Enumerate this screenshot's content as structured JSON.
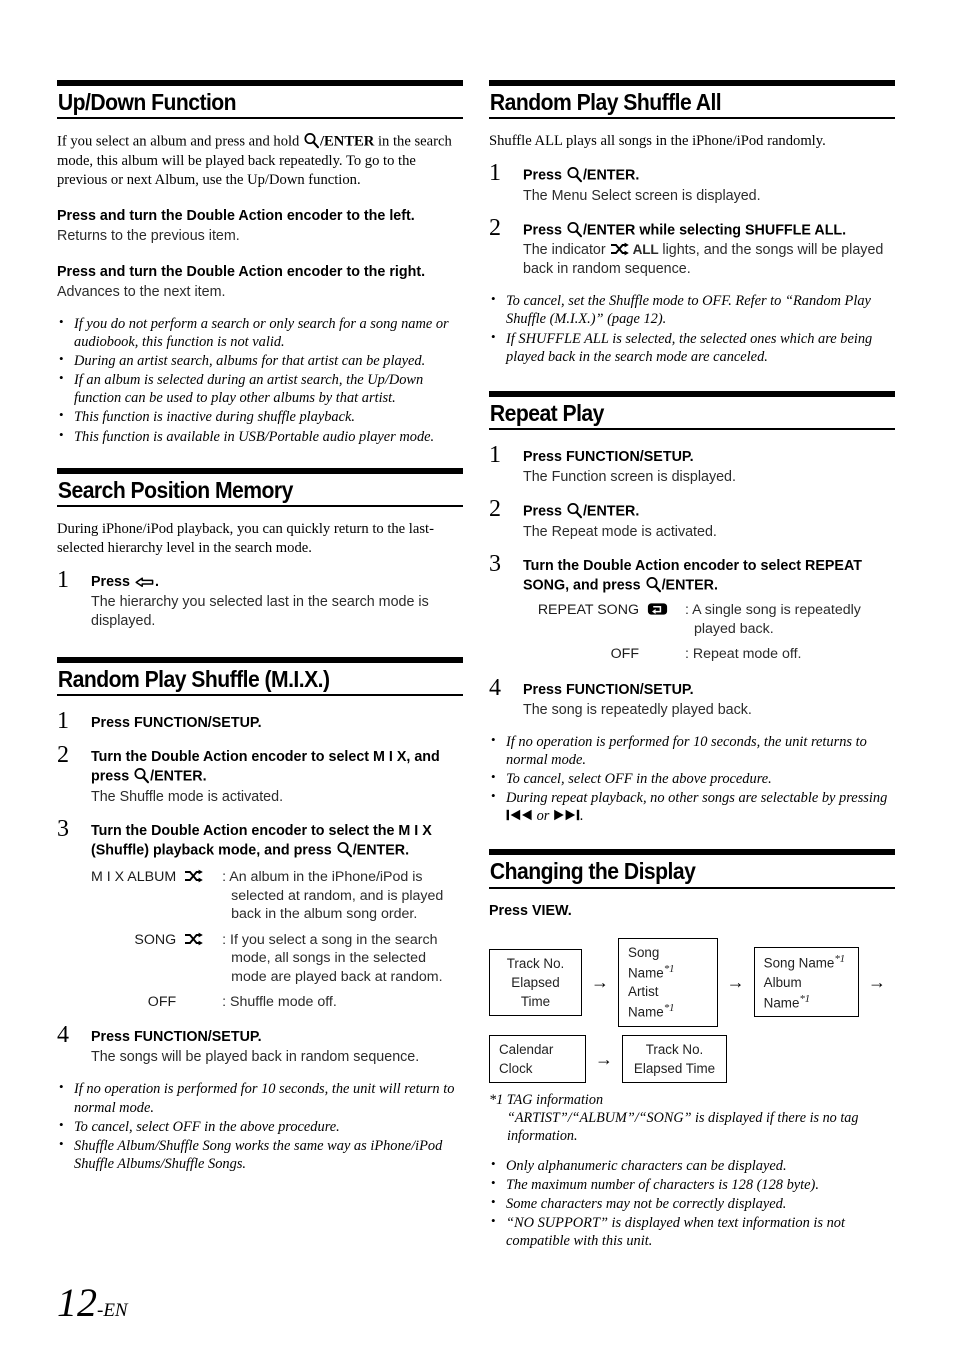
{
  "page": {
    "number": "12",
    "suffix": "-EN"
  },
  "sections": {
    "up_down": {
      "title": "Up/Down Function",
      "intro": "If you select an album and press and hold Ⓕ/ENTER in the search mode, this album will be played back repeatedly. To go to the previous or next Album, use the Up/Down function.",
      "intro_a": "If you select an album and press and hold ",
      "intro_enter": "/ENTER",
      "intro_b": " in the search mode, this album will be played back repeatedly. To go to the previous or next Album, use the Up/Down function.",
      "instr1_a": "Press and turn the ",
      "instr1_bold": "Double Action encoder",
      "instr1_b": " to the left.",
      "instr1_desc": "Returns to the previous item.",
      "instr2_a": "Press and turn the ",
      "instr2_bold": "Double Action encoder",
      "instr2_b": " to the right.",
      "instr2_desc": "Advances to the next item.",
      "notes": [
        "If you do not perform a search or only search for a song name or audiobook, this function is not valid.",
        "During an artist search, albums for that artist can be played.",
        "If an album is selected during an artist search, the Up/Down function can be used to play other albums by that artist.",
        "This function is inactive during shuffle playback.",
        "This function is available in USB/Portable audio player mode."
      ]
    },
    "search_position": {
      "title": "Search Position Memory",
      "intro": "During iPhone/iPod playback, you can quickly return to the last-selected hierarchy level in the search mode.",
      "step1_num": "1",
      "step1_press": "Press",
      "step1_period": ".",
      "step1_desc": "The hierarchy you selected last in the search mode is displayed."
    },
    "random_mix": {
      "title": "Random Play Shuffle (M.I.X.)",
      "step1_num": "1",
      "step1_a": "Press ",
      "step1_bold": "FUNCTION/SETUP",
      "step1_b": ".",
      "step2_num": "2",
      "step2_a": "Turn the ",
      "step2_bold": "Double Action encoder",
      "step2_b": " to select M I X, and press ",
      "step2_enter": "/ENTER",
      "step2_c": ".",
      "step2_desc": "The Shuffle mode is activated.",
      "step3_num": "3",
      "step3_a": "Turn the ",
      "step3_bold": "Double Action encoder",
      "step3_b": " to select the M I X (Shuffle) playback mode, and press ",
      "step3_enter": "/ENTER",
      "step3_c": ".",
      "options": [
        {
          "label": "M I X ALBUM",
          "icon": "shuffle-icon",
          "desc": ": An album in the iPhone/iPod is selected at random, and is played back in the album song order."
        },
        {
          "label": "SONG",
          "icon": "shuffle-icon",
          "desc": ": If you select a song in the search mode, all songs in the selected mode are played back at random."
        },
        {
          "label": "OFF",
          "icon": "",
          "desc": ": Shuffle mode off."
        }
      ],
      "step4_num": "4",
      "step4_a": "Press ",
      "step4_bold": "FUNCTION/SETUP",
      "step4_b": ".",
      "step4_desc": "The songs will be played back in random sequence.",
      "notes": [
        "If no operation is performed for 10 seconds, the unit will return to normal mode.",
        "To cancel, select OFF in the above procedure.",
        "Shuffle Album/Shuffle Song works the same way as iPhone/iPod Shuffle Albums/Shuffle Songs."
      ]
    },
    "shuffle_all": {
      "title": "Random Play Shuffle All",
      "intro": "Shuffle ALL plays all songs in the iPhone/iPod randomly.",
      "step1_num": "1",
      "step1_a": "Press ",
      "step1_enter": "/ENTER",
      "step1_b": ".",
      "step1_desc": "The Menu Select screen is displayed.",
      "step2_num": "2",
      "step2_a": "Press ",
      "step2_enter": "/ENTER",
      "step2_b": " while selecting SHUFFLE ALL.",
      "step2_desc_a": "The indicator ",
      "step2_desc_all": "ALL",
      "step2_desc_b": " lights, and the songs will be played back in random sequence.",
      "notes": [
        "To cancel, set the Shuffle mode to OFF. Refer to “Random Play Shuffle (M.I.X.)” (page 12).",
        "If SHUFFLE ALL is selected, the selected ones which are being played back in the search mode are canceled."
      ]
    },
    "repeat_play": {
      "title": "Repeat Play",
      "step1_num": "1",
      "step1_a": "Press ",
      "step1_bold": "FUNCTION/SETUP",
      "step1_b": ".",
      "step1_desc": "The Function screen is displayed.",
      "step2_num": "2",
      "step2_a": "Press ",
      "step2_enter": "/ENTER",
      "step2_b": ".",
      "step2_desc": "The Repeat mode is activated.",
      "step3_num": "3",
      "step3_a": "Turn the ",
      "step3_bold": "Double Action encoder",
      "step3_b": " to select REPEAT SONG, and press ",
      "step3_enter": "/ENTER",
      "step3_c": ".",
      "options": [
        {
          "label": "REPEAT SONG",
          "icon": "repeat-icon",
          "desc": ": A single song is repeatedly played back."
        },
        {
          "label": "OFF",
          "icon": "",
          "desc": ": Repeat mode off."
        }
      ],
      "step4_num": "4",
      "step4_a": "Press ",
      "step4_bold": "FUNCTION/SETUP",
      "step4_b": ".",
      "step4_desc": "The song is repeatedly played back.",
      "notes_pre": [
        "If no operation is performed for 10 seconds, the unit returns to normal mode.",
        "To cancel, select OFF in the above procedure."
      ],
      "note_last_a": "During repeat playback, no other songs are selectable by pressing ",
      "note_last_or": " or ",
      "note_last_b": "."
    },
    "changing_display": {
      "title": "Changing the Display",
      "press_a": "Press ",
      "press_bold": "VIEW",
      "press_b": ".",
      "flow": {
        "row1": [
          {
            "lines": [
              "Track No.",
              "Elapsed Time"
            ],
            "marks": [
              false,
              false
            ],
            "align": "center"
          },
          {
            "lines": [
              "Song Name",
              "Artist Name"
            ],
            "marks": [
              true,
              true
            ],
            "align": "left"
          },
          {
            "lines": [
              "Song Name",
              "Album Name"
            ],
            "marks": [
              true,
              true
            ],
            "align": "left"
          }
        ],
        "row2": [
          {
            "lines": [
              "Calendar",
              "Clock"
            ],
            "marks": [
              false,
              false
            ],
            "align": "left"
          },
          {
            "lines": [
              "Track No.",
              "Elapsed Time"
            ],
            "marks": [
              false,
              false
            ],
            "align": "center"
          }
        ],
        "arrow": "→",
        "mark": "*1"
      },
      "footnote_mark": "*1",
      "footnote_title": " TAG information",
      "footnote_body": "“ARTIST”/“ALBUM”/“SONG” is displayed if there is no tag information.",
      "notes": [
        "Only alphanumeric characters can be displayed.",
        "The maximum number of characters is 128 (128 byte).",
        "Some characters may not be correctly displayed.",
        "“NO SUPPORT” is displayed when text information is not compatible with this unit."
      ]
    }
  }
}
